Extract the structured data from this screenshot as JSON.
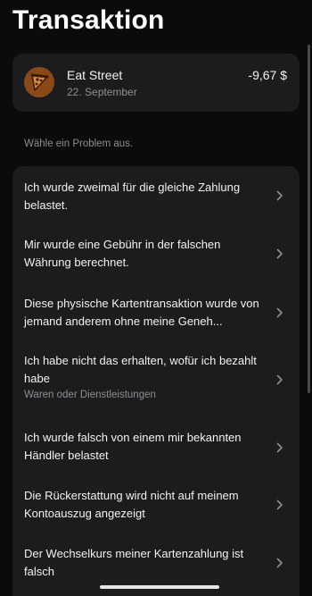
{
  "header": {
    "title": "Transaktion"
  },
  "transaction": {
    "merchant": "Eat Street",
    "date": "22. September",
    "amount": "-9,67 $",
    "icon": "pizza-icon"
  },
  "problems": {
    "section_label": "Wähle ein Problem aus.",
    "items": [
      {
        "label": "Ich wurde zweimal für die gleiche Zahlung belastet.",
        "sub": ""
      },
      {
        "label": "Mir wurde eine Gebühr in der falschen Währung berechnet.",
        "sub": ""
      },
      {
        "label": "Diese physische Kartentransaktion wurde von jemand anderem ohne meine Geneh...",
        "sub": ""
      },
      {
        "label": "Ich habe nicht das erhalten, wofür ich bezahlt habe",
        "sub": "Waren oder Dienstleistungen"
      },
      {
        "label": "Ich wurde falsch von einem mir bekannten Händler belastet",
        "sub": ""
      },
      {
        "label": "Die Rückerstattung wird nicht auf meinem Kontoauszug angezeigt",
        "sub": ""
      },
      {
        "label": "Der Wechselkurs meiner Kartenzahlung ist falsch",
        "sub": ""
      }
    ]
  },
  "colors": {
    "background": "#0b0b0c",
    "card": "#1c1c1e",
    "secondary_text": "#8e8e93",
    "merchant_icon_bg": "#8a4a17"
  }
}
